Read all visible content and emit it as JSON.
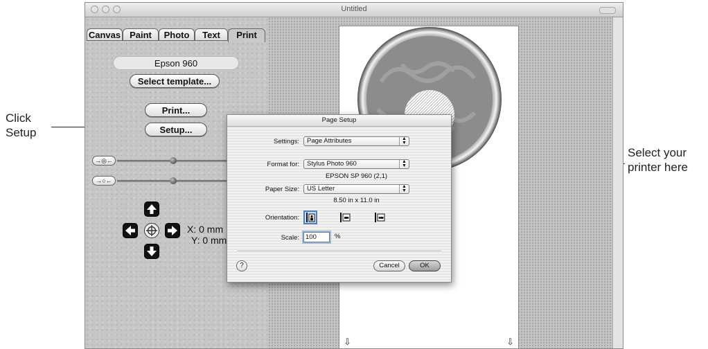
{
  "callouts": {
    "left_line1": "Click",
    "left_line2": "Setup",
    "right_line1": "Select your",
    "right_line2": "printer here"
  },
  "window": {
    "title": "Untitled"
  },
  "left_pane": {
    "tabs": [
      {
        "label": "Canvas"
      },
      {
        "label": "Paint"
      },
      {
        "label": "Photo"
      },
      {
        "label": "Text"
      },
      {
        "label": "Print",
        "active": true
      }
    ],
    "printer_name": "Epson 960",
    "select_template_label": "Select template...",
    "print_label": "Print...",
    "setup_label": "Setup...",
    "x_readout": "X: 0 mm",
    "y_readout": "Y: 0 mm"
  },
  "dialog": {
    "title": "Page Setup",
    "settings_label": "Settings:",
    "settings_value": "Page Attributes",
    "format_for_label": "Format for:",
    "format_for_value": "Stylus Photo 960",
    "format_for_subtext": "EPSON SP 960 (2,1)",
    "paper_size_label": "Paper Size:",
    "paper_size_value": "US Letter",
    "paper_size_subtext": "8.50 in x 11.0 in",
    "orientation_label": "Orientation:",
    "scale_label": "Scale:",
    "scale_value": "100",
    "scale_unit": "%",
    "help_label": "?",
    "cancel_label": "Cancel",
    "ok_label": "OK"
  },
  "colors": {
    "window_chrome": "#d8d8d8",
    "dialog_bg": "#ececec",
    "callout_text": "#222222"
  },
  "icons": {
    "close": "window-close-icon",
    "minimize": "window-minimize-icon",
    "zoom": "window-zoom-icon",
    "up": "arrow-up-icon",
    "down": "arrow-down-icon",
    "left": "arrow-left-icon",
    "right": "arrow-right-icon",
    "center": "crosshair-icon"
  }
}
